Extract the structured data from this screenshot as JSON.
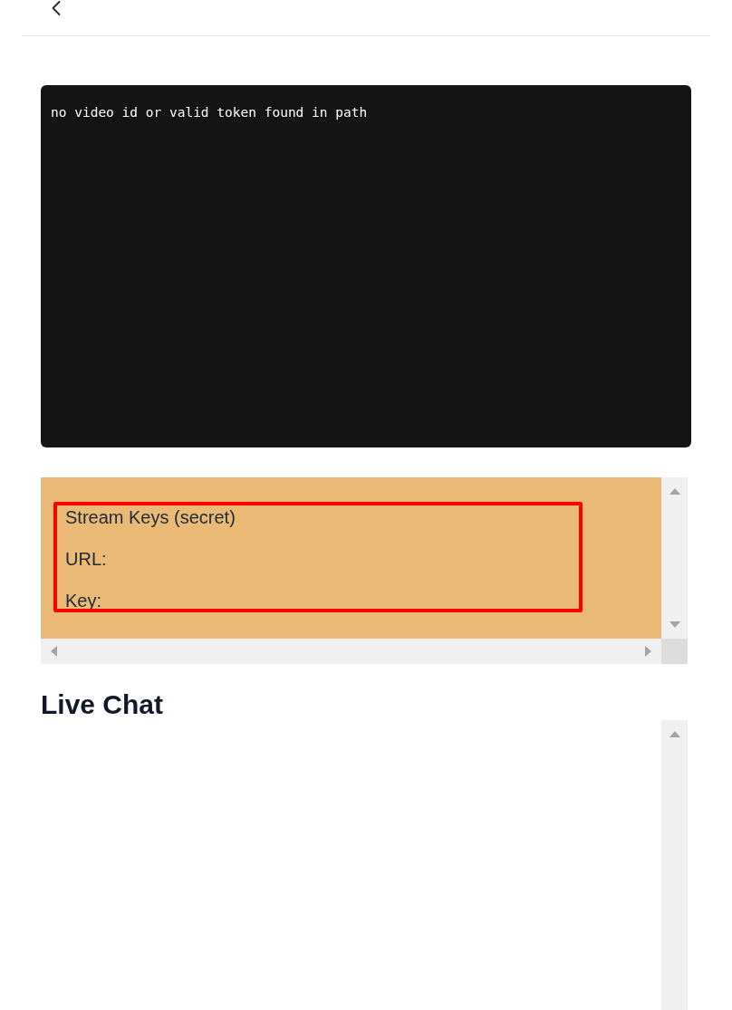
{
  "video_player": {
    "message": "no video id or valid token found in path"
  },
  "stream_keys": {
    "title": "Stream Keys (secret)",
    "fields": [
      {
        "label": "URL:"
      },
      {
        "label": "Key:"
      }
    ]
  },
  "live_chat": {
    "title": "Live Chat"
  }
}
